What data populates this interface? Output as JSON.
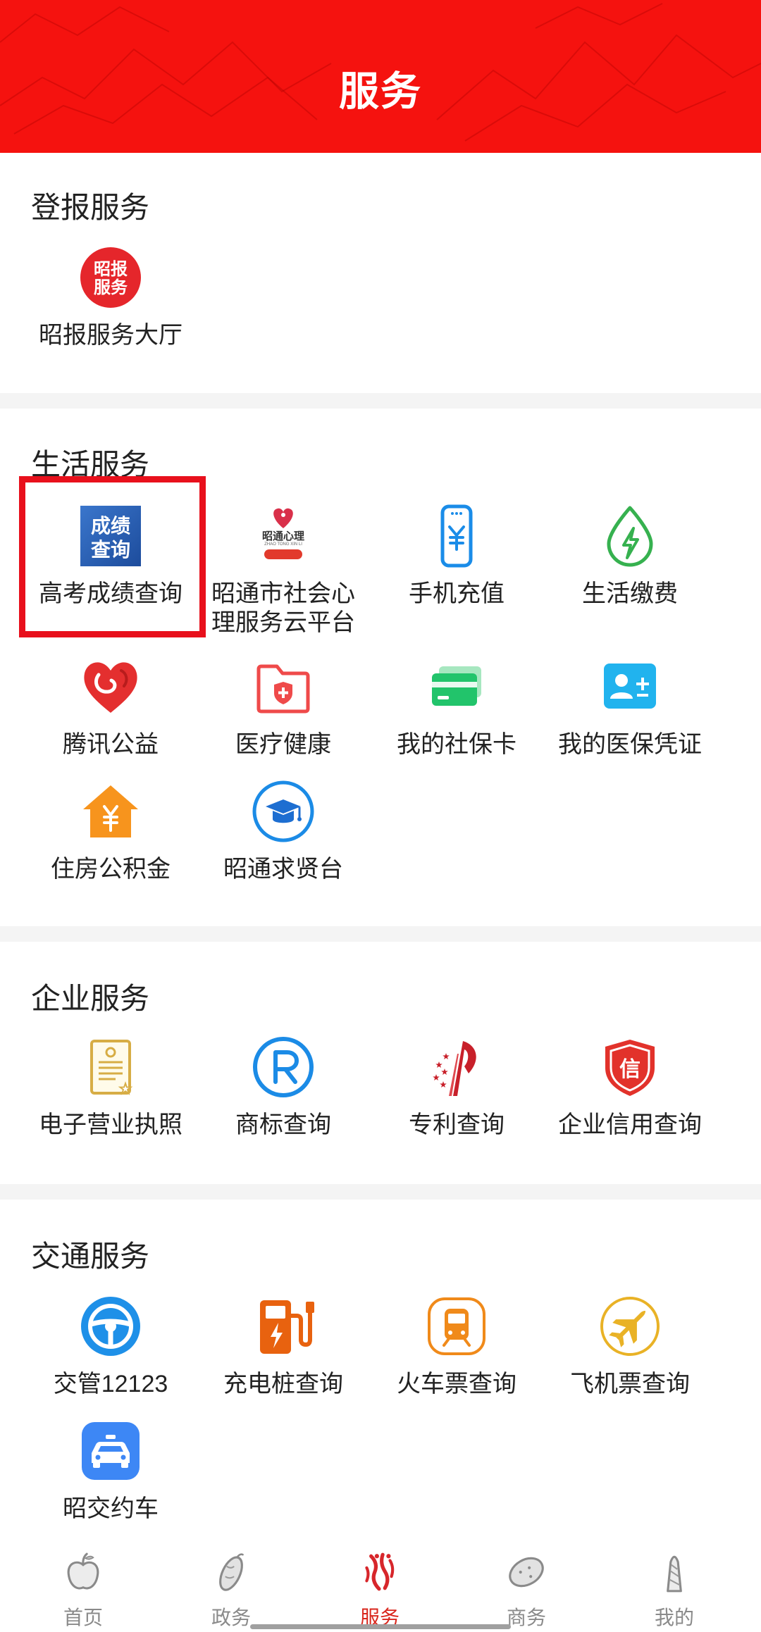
{
  "header": {
    "title": "服务"
  },
  "sections": [
    {
      "title": "登报服务",
      "items": [
        {
          "label": "昭报服务大厅",
          "icon": "zhaobao-service-logo-icon",
          "logo_text": [
            "昭报",
            "服务"
          ]
        }
      ]
    },
    {
      "title": "生活服务",
      "items": [
        {
          "label": "高考成绩查询",
          "icon": "score-query-logo-icon",
          "logo_text": [
            "成绩",
            "查询"
          ]
        },
        {
          "label": "昭通市社会心理服务云平台",
          "icon": "zhaotong-psychology-logo-icon",
          "logo_text": [
            "昭通心理",
            "ZHAO TONG XIN LI"
          ]
        },
        {
          "label": "手机充值",
          "icon": "phone-recharge-icon"
        },
        {
          "label": "生活缴费",
          "icon": "bill-payment-icon"
        },
        {
          "label": "腾讯公益",
          "icon": "tencent-charity-heart-icon"
        },
        {
          "label": "医疗健康",
          "icon": "medical-folder-icon"
        },
        {
          "label": "我的社保卡",
          "icon": "social-security-card-icon"
        },
        {
          "label": "我的医保凭证",
          "icon": "medical-insurance-id-icon"
        },
        {
          "label": "住房公积金",
          "icon": "housing-fund-icon"
        },
        {
          "label": "昭通求贤台",
          "icon": "graduation-cap-icon"
        }
      ]
    },
    {
      "title": "企业服务",
      "items": [
        {
          "label": "电子营业执照",
          "icon": "business-license-icon"
        },
        {
          "label": "商标查询",
          "icon": "trademark-icon"
        },
        {
          "label": "专利查询",
          "icon": "patent-icon"
        },
        {
          "label": "企业信用查询",
          "icon": "credit-shield-icon",
          "logo_text": [
            "信"
          ]
        }
      ]
    },
    {
      "title": "交通服务",
      "items": [
        {
          "label": "交管12123",
          "icon": "steering-wheel-icon"
        },
        {
          "label": "充电桩查询",
          "icon": "charging-pile-icon"
        },
        {
          "label": "火车票查询",
          "icon": "train-icon"
        },
        {
          "label": "飞机票查询",
          "icon": "airplane-icon"
        },
        {
          "label": "昭交约车",
          "icon": "taxi-icon"
        }
      ]
    }
  ],
  "nav": {
    "items": [
      {
        "label": "首页",
        "icon": "apple-icon",
        "active": false
      },
      {
        "label": "政务",
        "icon": "sweet-potato-icon",
        "active": false
      },
      {
        "label": "服务",
        "icon": "chili-icon",
        "active": true
      },
      {
        "label": "商务",
        "icon": "potato-icon",
        "active": false
      },
      {
        "label": "我的",
        "icon": "bamboo-shoot-icon",
        "active": false
      }
    ]
  },
  "colors": {
    "header_red": "#f5120f",
    "active_nav": "#d9261c",
    "inactive_nav": "#8a8a8a",
    "highlight_box": "#e8101c",
    "separator": "#f4f4f4"
  }
}
